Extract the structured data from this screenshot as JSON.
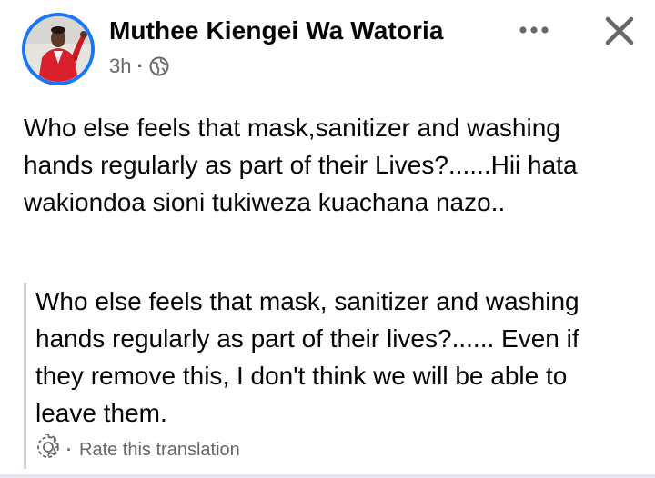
{
  "post": {
    "author_name": "Muthee Kiengei Wa Watoria",
    "timestamp": "3h",
    "separator": "·",
    "privacy_icon": "globe-icon",
    "more_icon": "more-options-icon",
    "close_icon": "close-icon",
    "text": "Who else feels that mask,sanitizer and washing hands regularly as part of their Lives?......Hii hata wakiondoa sioni tukiweza kuachana nazo..",
    "translation": {
      "text": "Who else feels that mask, sanitizer and washing hands regularly as part of their lives?...... Even if they remove this, I don't think we will be able to leave them.",
      "settings_icon": "gear-icon",
      "separator": "·",
      "rate_label": "Rate this translation"
    }
  },
  "colors": {
    "avatar_ring": "#1877f2",
    "secondary_text": "#65676b",
    "quote_border": "#cfd2d6"
  }
}
